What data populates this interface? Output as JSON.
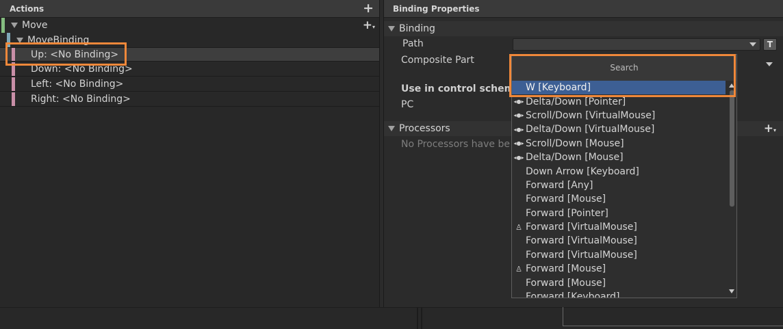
{
  "actions_panel": {
    "title": "Actions",
    "add_icon": "plus-icon",
    "action": {
      "label": "Move",
      "add_icon": "plus-dropdown-icon"
    },
    "composite": {
      "label": "MoveBinding"
    },
    "parts": [
      {
        "label": "Up: <No Binding>"
      },
      {
        "label": "Down: <No Binding>"
      },
      {
        "label": "Left: <No Binding>"
      },
      {
        "label": "Right: <No Binding>"
      }
    ],
    "colors": {
      "action": "#85bd80",
      "composite": "#7fa8b8",
      "part": "#c98fa8"
    }
  },
  "properties_panel": {
    "title": "Binding Properties",
    "binding_section": "Binding",
    "path_label": "Path",
    "t_button": "T",
    "composite_part_label": "Composite Part",
    "control_schemes_label": "Use in control scheme",
    "scheme_pc": "PC",
    "processors_section": "Processors",
    "processors_empty": "No Processors have be"
  },
  "dropdown": {
    "search_placeholder": "Search",
    "items": [
      {
        "label": "W [Keyboard]",
        "icon": "",
        "selected": true
      },
      {
        "label": "Delta/Down [Pointer]",
        "icon": "gamepad-icon"
      },
      {
        "label": "Scroll/Down [VirtualMouse]",
        "icon": "gamepad-icon"
      },
      {
        "label": "Delta/Down [VirtualMouse]",
        "icon": "gamepad-icon"
      },
      {
        "label": "Scroll/Down [Mouse]",
        "icon": "gamepad-icon"
      },
      {
        "label": "Delta/Down [Mouse]",
        "icon": "gamepad-icon"
      },
      {
        "label": "Down Arrow [Keyboard]",
        "icon": ""
      },
      {
        "label": "Forward [Any]",
        "icon": ""
      },
      {
        "label": "Forward [Mouse]",
        "icon": ""
      },
      {
        "label": "Forward [Pointer]",
        "icon": ""
      },
      {
        "label": "Forward [VirtualMouse]",
        "icon": "joystick-icon"
      },
      {
        "label": "Forward [VirtualMouse]",
        "icon": ""
      },
      {
        "label": "Forward [VirtualMouse]",
        "icon": ""
      },
      {
        "label": "Forward [Mouse]",
        "icon": "joystick-icon"
      },
      {
        "label": "Forward [Mouse]",
        "icon": ""
      },
      {
        "label": "Forward [Keyboard]",
        "icon": ""
      }
    ]
  },
  "highlight_color": "#f0883a"
}
